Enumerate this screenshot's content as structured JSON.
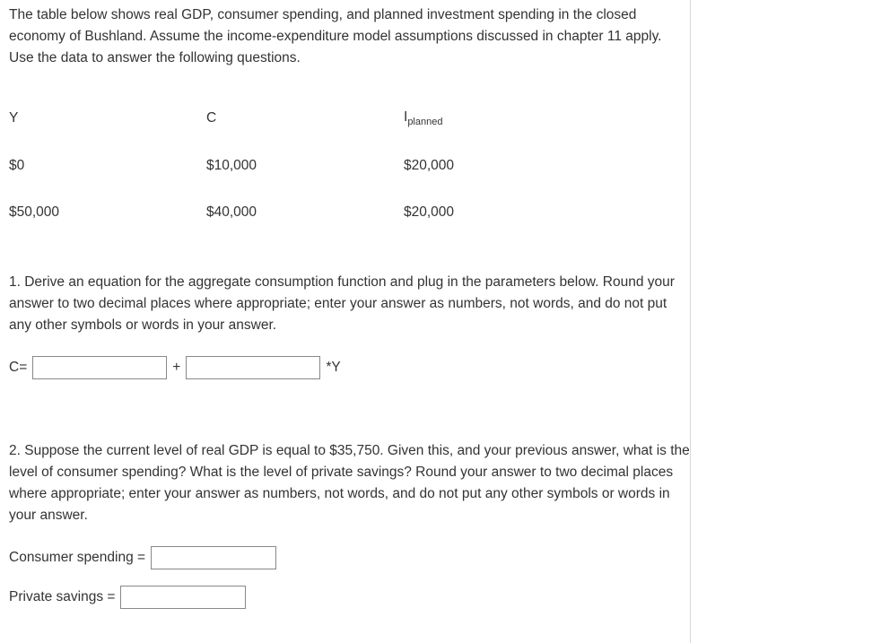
{
  "intro": "The table below shows real GDP, consumer spending, and planned investment spending in the closed economy of Bushland. Assume the income-expenditure model assumptions discussed in chapter 11 apply. Use the data to answer the following questions.",
  "table": {
    "headers": {
      "y": "Y",
      "c": "C",
      "i_prefix": "I",
      "i_sub": "planned"
    },
    "rows": [
      {
        "y": "$0",
        "c": "$10,000",
        "i": "$20,000"
      },
      {
        "y": "$50,000",
        "c": "$40,000",
        "i": "$20,000"
      }
    ]
  },
  "q1": {
    "text": "1. Derive an equation for the aggregate consumption function and plug in the parameters below. Round your answer to two decimal places where appropriate; enter your answer as numbers, not words, and do not put any other symbols or words in your answer.",
    "lhs": "C=",
    "plus": "+",
    "suffix": "*Y"
  },
  "q2": {
    "text": "2. Suppose the current level of real GDP is equal to $35,750. Given this, and your previous answer, what is the level of consumer spending? What is the level of private savings? Round your answer to two decimal places where appropriate; enter your answer as numbers, not words, and do not put any other symbols or words in your answer.",
    "cs_label": "Consumer spending =",
    "ps_label": "Private savings ="
  }
}
